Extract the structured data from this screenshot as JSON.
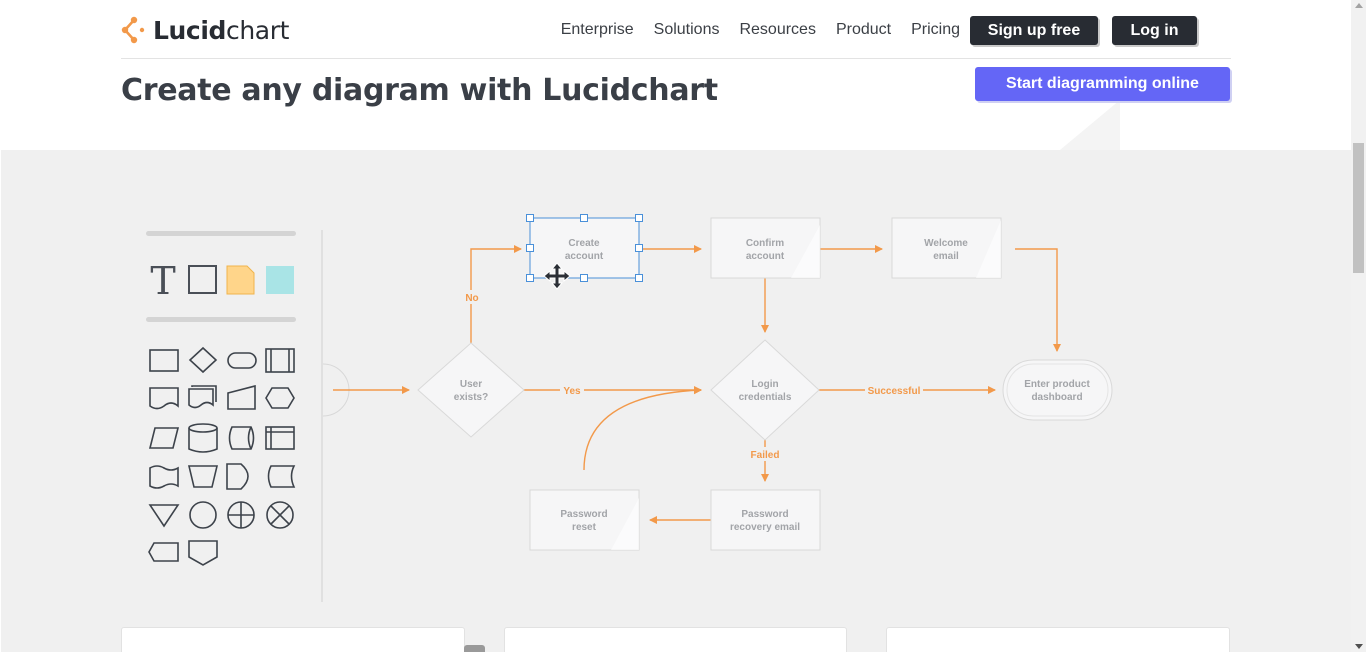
{
  "header": {
    "logo_text_bold": "Lucid",
    "logo_text_light": "chart",
    "nav": [
      "Enterprise",
      "Solutions",
      "Resources",
      "Product",
      "Pricing"
    ],
    "signup_label": "Sign up free",
    "login_label": "Log in"
  },
  "hero": {
    "title": "Create any diagram with Lucidchart",
    "cta_label": "Start diagramming online"
  },
  "toolbar": {
    "text_tool_glyph": "T",
    "shape_icons": [
      "rectangle-icon",
      "diamond-icon",
      "terminator-icon",
      "predefined-process-icon",
      "document-icon",
      "multi-document-icon",
      "manual-input-icon",
      "preparation-icon",
      "data-icon",
      "database-icon",
      "direct-access-storage-icon",
      "internal-storage-icon",
      "punched-tape-icon",
      "manual-operation-icon",
      "delay-icon",
      "stored-data-icon",
      "merge-icon",
      "connector-icon",
      "or-icon",
      "summing-junction-icon",
      "display-icon",
      "off-page-connector-icon"
    ]
  },
  "flowchart": {
    "nodes": {
      "create_account": [
        "Create",
        "account"
      ],
      "confirm_account": [
        "Confirm",
        "account"
      ],
      "welcome_email": [
        "Welcome",
        "email"
      ],
      "user_exists": [
        "User",
        "exists?"
      ],
      "login_credentials": [
        "Login",
        "credentials"
      ],
      "enter_dashboard": [
        "Enter product",
        "dashboard"
      ],
      "password_reset": [
        "Password",
        "reset"
      ],
      "password_recovery": [
        "Password",
        "recovery email"
      ]
    },
    "edge_labels": {
      "no": "No",
      "yes": "Yes",
      "successful": "Successful",
      "failed": "Failed"
    },
    "colors": {
      "arrow": "#f2994a",
      "selection": "#4a90d9",
      "node_text": "#a2a4a8"
    }
  }
}
